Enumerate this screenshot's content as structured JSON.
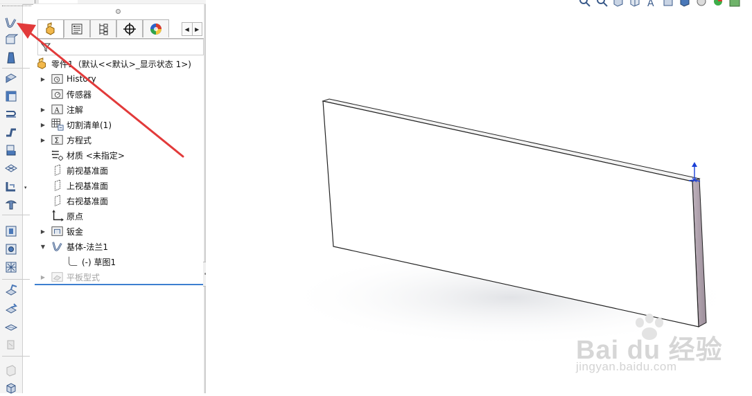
{
  "feature_manager": {
    "tree": {
      "root": "零件1（默认<<默认>_显示状态 1>)",
      "items": [
        {
          "label": "History",
          "icon": "history-folder-icon",
          "expandable": true
        },
        {
          "label": "传感器",
          "icon": "sensors-folder-icon",
          "expandable": false
        },
        {
          "label": "注解",
          "icon": "annotations-folder-icon",
          "expandable": true
        },
        {
          "label": "切割清单(1)",
          "icon": "cut-list-icon",
          "expandable": true
        },
        {
          "label": "方程式",
          "icon": "equations-folder-icon",
          "expandable": true
        },
        {
          "label": "材质 <未指定>",
          "icon": "material-icon",
          "expandable": false
        },
        {
          "label": "前视基准面",
          "icon": "plane-icon",
          "expandable": false
        },
        {
          "label": "上视基准面",
          "icon": "plane-icon",
          "expandable": false
        },
        {
          "label": "右视基准面",
          "icon": "plane-icon",
          "expandable": false
        },
        {
          "label": "原点",
          "icon": "origin-icon",
          "expandable": false
        },
        {
          "label": "钣金",
          "icon": "sheet-metal-folder-icon",
          "expandable": true
        },
        {
          "label": "基体-法兰1",
          "icon": "base-flange-icon",
          "expandable": true,
          "expanded": true
        },
        {
          "label": "(-) 草图1",
          "icon": "sketch-icon",
          "expandable": false,
          "child": true
        },
        {
          "label": "平板型式",
          "icon": "flat-pattern-icon",
          "expandable": true,
          "disabled": true
        }
      ]
    },
    "tabs": [
      {
        "name": "feature-manager-tab",
        "icon": "part-icon"
      },
      {
        "name": "property-manager-tab",
        "icon": "property-list-icon"
      },
      {
        "name": "configuration-manager-tab",
        "icon": "configuration-icon"
      },
      {
        "name": "dimxpert-tab",
        "icon": "crosshair-icon"
      },
      {
        "name": "display-manager-tab",
        "icon": "appearance-ball-icon"
      }
    ]
  },
  "watermark": {
    "brand": "Bai du 经验",
    "url": "jingyan.baidu.com"
  },
  "colors": {
    "accent": "#3d7fd0",
    "annotation_arrow": "#e23a3a",
    "panel_edge": "#a99aa7",
    "triad_blue": "#1a3fd6"
  }
}
